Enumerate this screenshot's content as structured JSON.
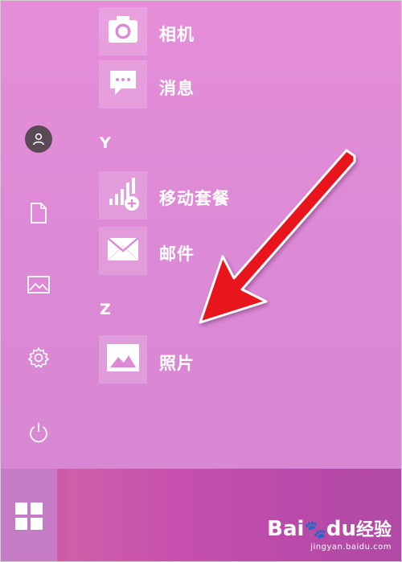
{
  "start_menu": {
    "apps": [
      {
        "label": "相机",
        "icon": "camera-icon"
      },
      {
        "label": "消息",
        "icon": "messaging-icon"
      },
      {
        "label": "移动套餐",
        "icon": "mobile-plans-icon"
      },
      {
        "label": "邮件",
        "icon": "mail-icon"
      },
      {
        "label": "照片",
        "icon": "photos-icon"
      }
    ],
    "section_letters": [
      "Y",
      "Z"
    ]
  },
  "rail": {
    "icons": [
      "user-avatar-icon",
      "documents-icon",
      "pictures-icon",
      "settings-gear-icon",
      "power-icon"
    ]
  },
  "taskbar": {
    "start_icon": "windows-logo-icon"
  },
  "annotation": {
    "arrow_color": "#e8121a"
  },
  "watermark": {
    "brand": "Bai",
    "paw": "du",
    "suffix": "经验",
    "url": "jingyan.baidu.com"
  },
  "colors": {
    "menu_bg": "#e08cd7",
    "taskbar": "#c24ea9",
    "tile_text": "#ffffff"
  }
}
